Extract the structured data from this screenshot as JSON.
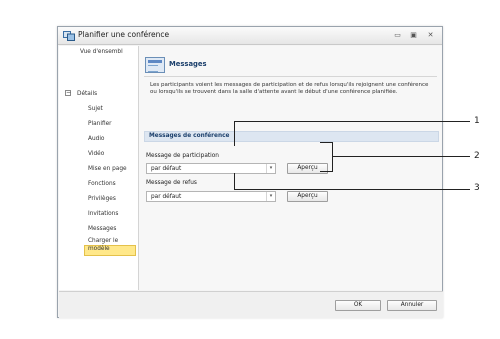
{
  "window": {
    "title": "Planifier une conférence",
    "controls": {
      "minimize": "▭",
      "maximize": "▣",
      "close": "✕"
    }
  },
  "sidebar": {
    "items": [
      {
        "label": "Vue d'ensembl"
      },
      {
        "label": "Détails",
        "toggle": "−"
      },
      {
        "label": "Sujet"
      },
      {
        "label": "Planifier"
      },
      {
        "label": "Audio"
      },
      {
        "label": "Vidéo"
      },
      {
        "label": "Mise en page"
      },
      {
        "label": "Fonctions"
      },
      {
        "label": "Privilèges"
      },
      {
        "label": "Invitations"
      },
      {
        "label": "Messages",
        "selected": true
      },
      {
        "label": "Charger le"
      },
      {
        "label": "modèle"
      }
    ]
  },
  "content": {
    "title": "Messages",
    "description": "Les participants voient les messages de participation et de refus lorsqu'ils rejoignent une conférence ou lorsqu'ils se trouvent dans la salle d'attente avant le début d'une conférence planifiée.",
    "subsection_title": "Messages de conférence",
    "participation": {
      "label": "Message de participation",
      "value": "par défaut",
      "preview_label": "Aperçu"
    },
    "refusal": {
      "label": "Message de refus",
      "value": "par défaut",
      "preview_label": "Aperçu"
    }
  },
  "footer": {
    "ok_label": "OK",
    "cancel_label": "Annuler"
  },
  "callouts": [
    "1",
    "2",
    "3"
  ]
}
